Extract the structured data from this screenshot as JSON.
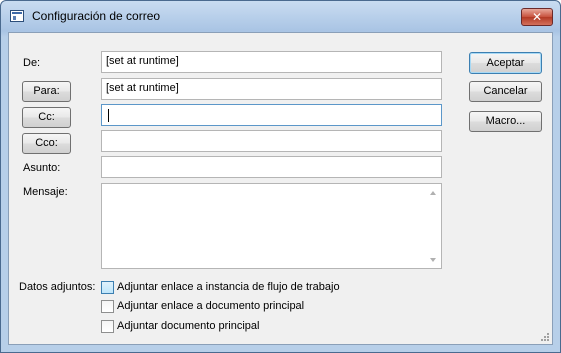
{
  "window": {
    "title": "Configuración de correo",
    "close_glyph": "✕"
  },
  "labels": {
    "from": "De:",
    "subject": "Asunto:",
    "message": "Mensaje:",
    "attachments": "Datos adjuntos:"
  },
  "buttons": {
    "to": "Para:",
    "cc": "Cc:",
    "bcc": "Cco:",
    "accept": "Aceptar",
    "cancel": "Cancelar",
    "macro": "Macro..."
  },
  "fields": {
    "from": "[set at runtime]",
    "to": "[set at runtime]",
    "cc": "",
    "bcc": "",
    "subject": "",
    "message": ""
  },
  "attachments": [
    {
      "label": "Adjuntar enlace a instancia de flujo de trabajo",
      "checked": false
    },
    {
      "label": "Adjuntar enlace a documento principal",
      "checked": false
    },
    {
      "label": "Adjuntar documento principal",
      "checked": false
    }
  ]
}
